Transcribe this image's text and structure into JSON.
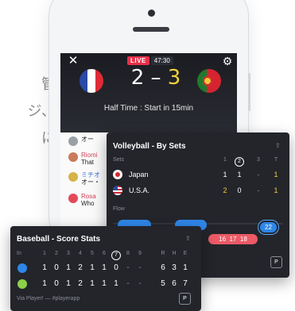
{
  "background_text": {
    "line1": "管",
    "line2": "ジ、",
    "line3": "に"
  },
  "phone": {
    "live_label": "LIVE",
    "clock": "47:30",
    "score": {
      "home": "2",
      "separator": "–",
      "away": "3"
    },
    "status": "Half Time : Start in 15min",
    "chat": [
      {
        "name": "",
        "message": "オー",
        "avatar_color": "#9aa0a6"
      },
      {
        "name": "Riomi",
        "message": "That",
        "avatar_color": "#c97a5a"
      },
      {
        "name": "ミチオ",
        "message": "オー・",
        "avatar_color": "#d6b24a"
      },
      {
        "name": "Rosa",
        "message": "Who",
        "avatar_color": "#e24a58"
      }
    ]
  },
  "volleyball": {
    "title": "Volleyball - By Sets",
    "sets_label": "Sets",
    "columns": [
      "1",
      "2",
      "3",
      "T"
    ],
    "current_set_index": 1,
    "teams": [
      {
        "name": "Japan",
        "flag": "japan-flag",
        "cells": [
          "1",
          "1",
          "-",
          "1"
        ]
      },
      {
        "name": "U.S.A.",
        "flag": "usa-flag",
        "cells": [
          "2",
          "0",
          "-",
          "1"
        ]
      }
    ],
    "flow_label": "Flow",
    "flow_pills_blue": [
      "",
      "",
      "22"
    ],
    "flow_pills_red": [
      "16",
      "17",
      "18"
    ],
    "brand_icon": "P"
  },
  "baseball": {
    "title": "Baseball - Score Stats",
    "inning_label": "In",
    "innings": [
      "1",
      "2",
      "3",
      "4",
      "5",
      "6",
      "7",
      "8",
      "9"
    ],
    "current_inning_index": 6,
    "totals_header": [
      "R",
      "H",
      "E"
    ],
    "teams": [
      {
        "color": "#2f86e8",
        "innings": [
          "1",
          "0",
          "1",
          "2",
          "1",
          "1",
          "0",
          "-",
          "-"
        ],
        "totals": [
          "6",
          "3",
          "1"
        ]
      },
      {
        "color": "#8bd14a",
        "innings": [
          "1",
          "0",
          "1",
          "2",
          "1",
          "1",
          "1",
          "-",
          "-"
        ],
        "totals": [
          "5",
          "6",
          "7"
        ]
      }
    ],
    "footer": "Via Player! — #playerapp",
    "brand_icon": "P"
  }
}
